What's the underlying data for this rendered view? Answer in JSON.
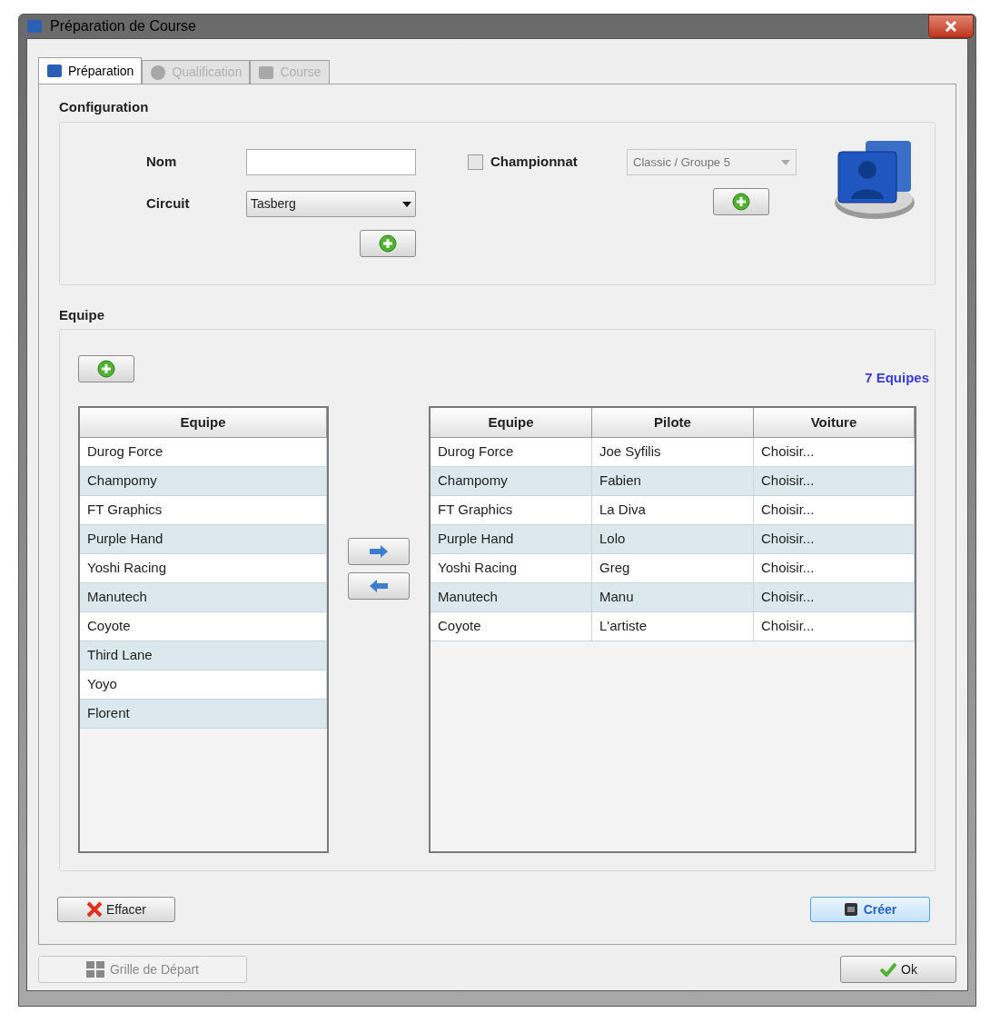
{
  "window": {
    "title": "Préparation de Course"
  },
  "tabs": [
    {
      "label": "Préparation",
      "selected": true,
      "disabled": false
    },
    {
      "label": "Qualification",
      "selected": false,
      "disabled": true
    },
    {
      "label": "Course",
      "selected": false,
      "disabled": true
    }
  ],
  "configuration": {
    "title": "Configuration",
    "nom_label": "Nom",
    "circuit_label": "Circuit",
    "circuit_value": "Tasberg",
    "championnat": {
      "label": "Championnat",
      "checked": false
    },
    "championnat_select": {
      "value": "Classic / Groupe 5",
      "disabled": true
    }
  },
  "equipe": {
    "title": "Equipe",
    "count": "7 Equipes",
    "left_table": {
      "columns": [
        "Equipe"
      ],
      "rows": [
        [
          "Durog Force"
        ],
        [
          "Champomy"
        ],
        [
          "FT Graphics"
        ],
        [
          "Purple Hand"
        ],
        [
          "Yoshi Racing"
        ],
        [
          "Manutech"
        ],
        [
          "Coyote"
        ],
        [
          "Third Lane"
        ],
        [
          "Yoyo"
        ],
        [
          "Florent"
        ]
      ]
    },
    "right_table": {
      "columns": [
        "Equipe",
        "Pilote",
        "Voiture"
      ],
      "rows": [
        [
          "Durog Force",
          "Joe Syfilis",
          "Choisir..."
        ],
        [
          "Champomy",
          "Fabien",
          "Choisir..."
        ],
        [
          "FT Graphics",
          "La Diva",
          "Choisir..."
        ],
        [
          "Purple Hand",
          "Lolo",
          "Choisir..."
        ],
        [
          "Yoshi Racing",
          "Greg",
          "Choisir..."
        ],
        [
          "Manutech",
          "Manu",
          "Choisir..."
        ],
        [
          "Coyote",
          "L'artiste",
          "Choisir..."
        ]
      ]
    }
  },
  "actions": {
    "effacer": "Effacer",
    "creer": "Créer"
  },
  "footer": {
    "grille": {
      "label": "Grille de Départ",
      "disabled": true
    },
    "ok": "Ok"
  }
}
